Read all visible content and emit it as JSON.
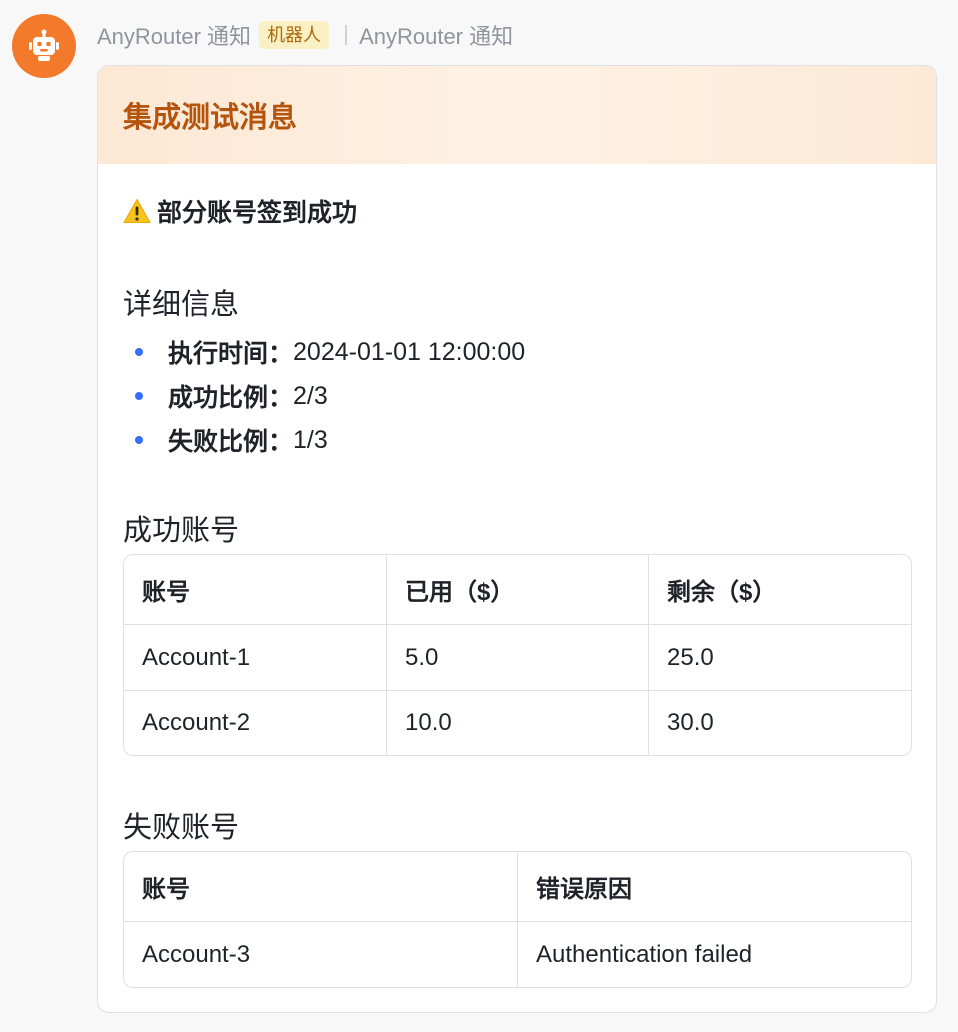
{
  "sender": {
    "name": "AnyRouter 通知",
    "badge": "机器人",
    "channel": "AnyRouter 通知",
    "avatar_icon": "robot-icon",
    "avatar_color": "#f37a2b"
  },
  "card": {
    "title": "集成测试消息",
    "status_icon": "warning-icon",
    "status_text": "部分账号签到成功",
    "details": {
      "title": "详细信息",
      "items": [
        {
          "label": "执行时间：",
          "value": "2024-01-01 12:00:00"
        },
        {
          "label": "成功比例：",
          "value": "2/3"
        },
        {
          "label": "失败比例：",
          "value": "1/3"
        }
      ]
    },
    "success": {
      "title": "成功账号",
      "headers": [
        "账号",
        "已用（$）",
        "剩余（$）"
      ],
      "rows": [
        [
          "Account-1",
          "5.0",
          "25.0"
        ],
        [
          "Account-2",
          "10.0",
          "30.0"
        ]
      ]
    },
    "failed": {
      "title": "失败账号",
      "headers": [
        "账号",
        "错误原因"
      ],
      "rows": [
        [
          "Account-3",
          "Authentication failed"
        ]
      ]
    }
  },
  "colors": {
    "title": "#b5550d",
    "bullet": "#3370ff",
    "badge_bg": "#fbefc4"
  }
}
